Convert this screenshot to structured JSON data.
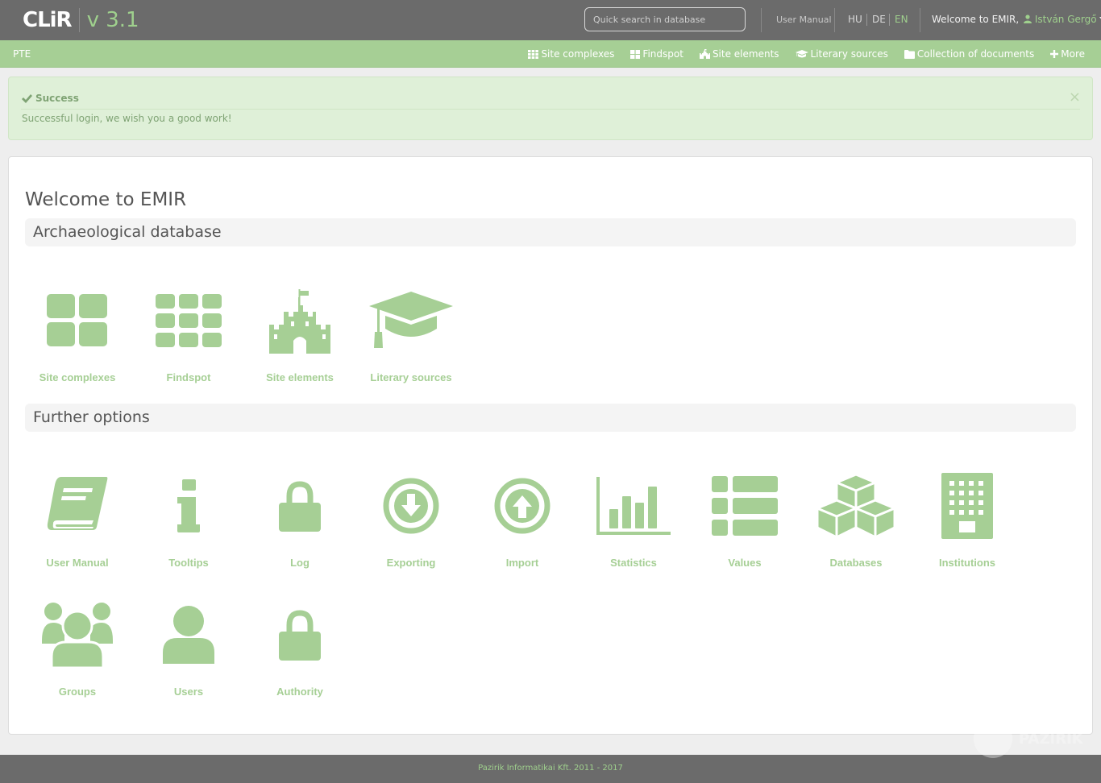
{
  "app": {
    "brand": "CLiR",
    "version": "v 3.1"
  },
  "topbar": {
    "search_placeholder": "Quick search in database",
    "user_manual": "User Manual",
    "languages": [
      "HU",
      "DE",
      "EN"
    ],
    "active_language": "EN",
    "welcome_prefix": "Welcome to EMIR,",
    "user_name": "István Gergő"
  },
  "navbar": {
    "brand": "PTE",
    "items": [
      {
        "label": "Site complexes",
        "icon": "grid-icon"
      },
      {
        "label": "Findspot",
        "icon": "th-large-icon"
      },
      {
        "label": "Site elements",
        "icon": "castle-icon"
      },
      {
        "label": "Literary sources",
        "icon": "graduation-cap-icon"
      },
      {
        "label": "Collection of documents",
        "icon": "folder-icon"
      },
      {
        "label": "More",
        "icon": "plus-icon"
      }
    ]
  },
  "alert": {
    "title": "Success",
    "message": "Successful login, we wish you a good work!",
    "close": "×"
  },
  "main": {
    "title": "Welcome to EMIR",
    "sections": [
      {
        "title": "Archaeological database",
        "tiles": [
          {
            "label": "Site complexes",
            "icon": "th-large-icon"
          },
          {
            "label": "Findspot",
            "icon": "grid-icon"
          },
          {
            "label": "Site elements",
            "icon": "castle-icon"
          },
          {
            "label": "Literary sources",
            "icon": "graduation-cap-icon"
          }
        ]
      },
      {
        "title": "Further options",
        "tiles": [
          {
            "label": "User Manual",
            "icon": "book-icon"
          },
          {
            "label": "Tooltips",
            "icon": "info-icon"
          },
          {
            "label": "Log",
            "icon": "lock-icon"
          },
          {
            "label": "Exporting",
            "icon": "download-icon"
          },
          {
            "label": "Import",
            "icon": "upload-icon"
          },
          {
            "label": "Statistics",
            "icon": "bar-chart-icon"
          },
          {
            "label": "Values",
            "icon": "list-icon"
          },
          {
            "label": "Databases",
            "icon": "cubes-icon"
          },
          {
            "label": "Institutions",
            "icon": "building-icon"
          },
          {
            "label": "Groups",
            "icon": "users-icon"
          },
          {
            "label": "Users",
            "icon": "user-icon"
          },
          {
            "label": "Authority",
            "icon": "lock-icon"
          }
        ]
      }
    ]
  },
  "footer": {
    "text": "Pazirik Informatikai Kft. 2011 - 2017",
    "watermark": "PAZIRIK"
  },
  "colors": {
    "topbar": "#6b6b6b",
    "accent": "#9fd08d",
    "navbar": "#a6cf95",
    "icon": "#a6cf95",
    "alert_bg": "#dff0d8"
  }
}
